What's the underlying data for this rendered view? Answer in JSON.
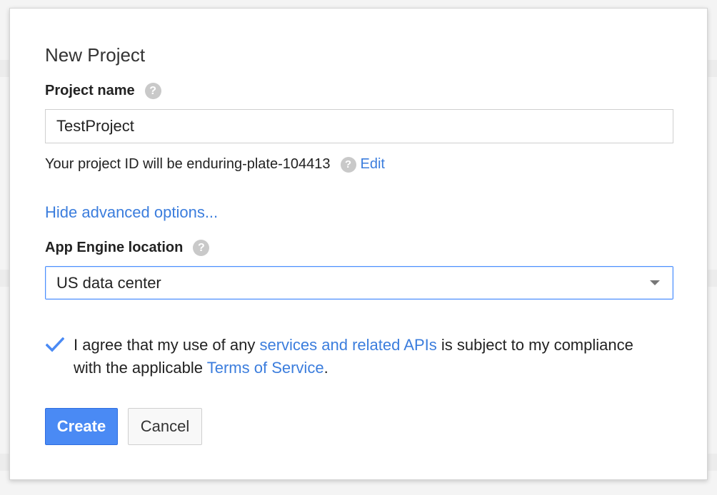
{
  "dialog": {
    "title": "New Project",
    "project_name": {
      "label": "Project name",
      "value": "TestProject"
    },
    "project_id": {
      "text": "Your project ID will be enduring-plate-104413",
      "edit_label": "Edit"
    },
    "advanced_link": "Hide advanced options...",
    "app_engine": {
      "label": "App Engine location",
      "selected": "US data center"
    },
    "agreement": {
      "checked": true,
      "part1": "I agree that my use of any ",
      "link1": "services and related APIs",
      "part2": " is subject to my compliance with the applicable ",
      "link2": "Terms of Service",
      "part3": "."
    },
    "buttons": {
      "create": "Create",
      "cancel": "Cancel"
    }
  },
  "colors": {
    "accent": "#4a8af4",
    "link": "#3b7ddd",
    "help_icon": "#c9c9c9"
  },
  "icons": {
    "help": "question-mark",
    "checkbox": "checkmark",
    "dropdown": "triangle-down"
  }
}
